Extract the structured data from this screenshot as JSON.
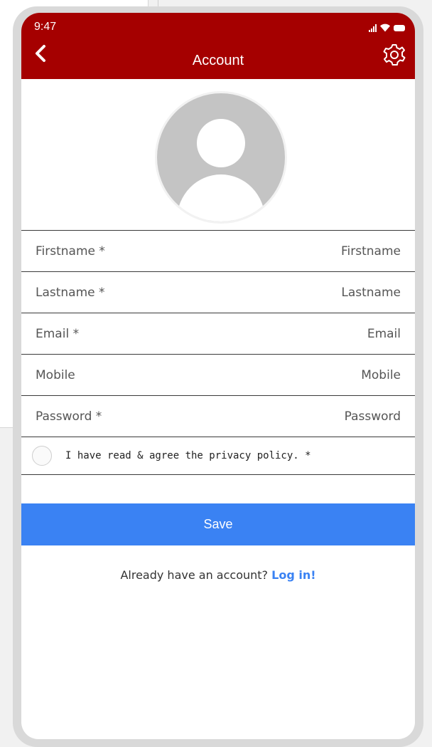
{
  "status_bar": {
    "time": "9:47"
  },
  "header": {
    "title": "Account"
  },
  "icons": {
    "back": "chevron-left-icon",
    "settings": "gear-icon",
    "avatar": "user-placeholder-icon"
  },
  "form": {
    "firstname": {
      "label": "Firstname *",
      "placeholder": "Firstname"
    },
    "lastname": {
      "label": "Lastname *",
      "placeholder": "Lastname"
    },
    "email": {
      "label": "Email *",
      "placeholder": "Email"
    },
    "mobile": {
      "label": "Mobile",
      "placeholder": "Mobile"
    },
    "password": {
      "label": "Password *",
      "placeholder": "Password"
    },
    "privacy": {
      "label": "I have read & agree the privacy policy. *"
    }
  },
  "actions": {
    "save_label": "Save"
  },
  "footer": {
    "prompt": "Already have an account?",
    "login_label": "Log in!"
  },
  "colors": {
    "header_bg": "#a50000",
    "accent": "#3a82f3"
  }
}
